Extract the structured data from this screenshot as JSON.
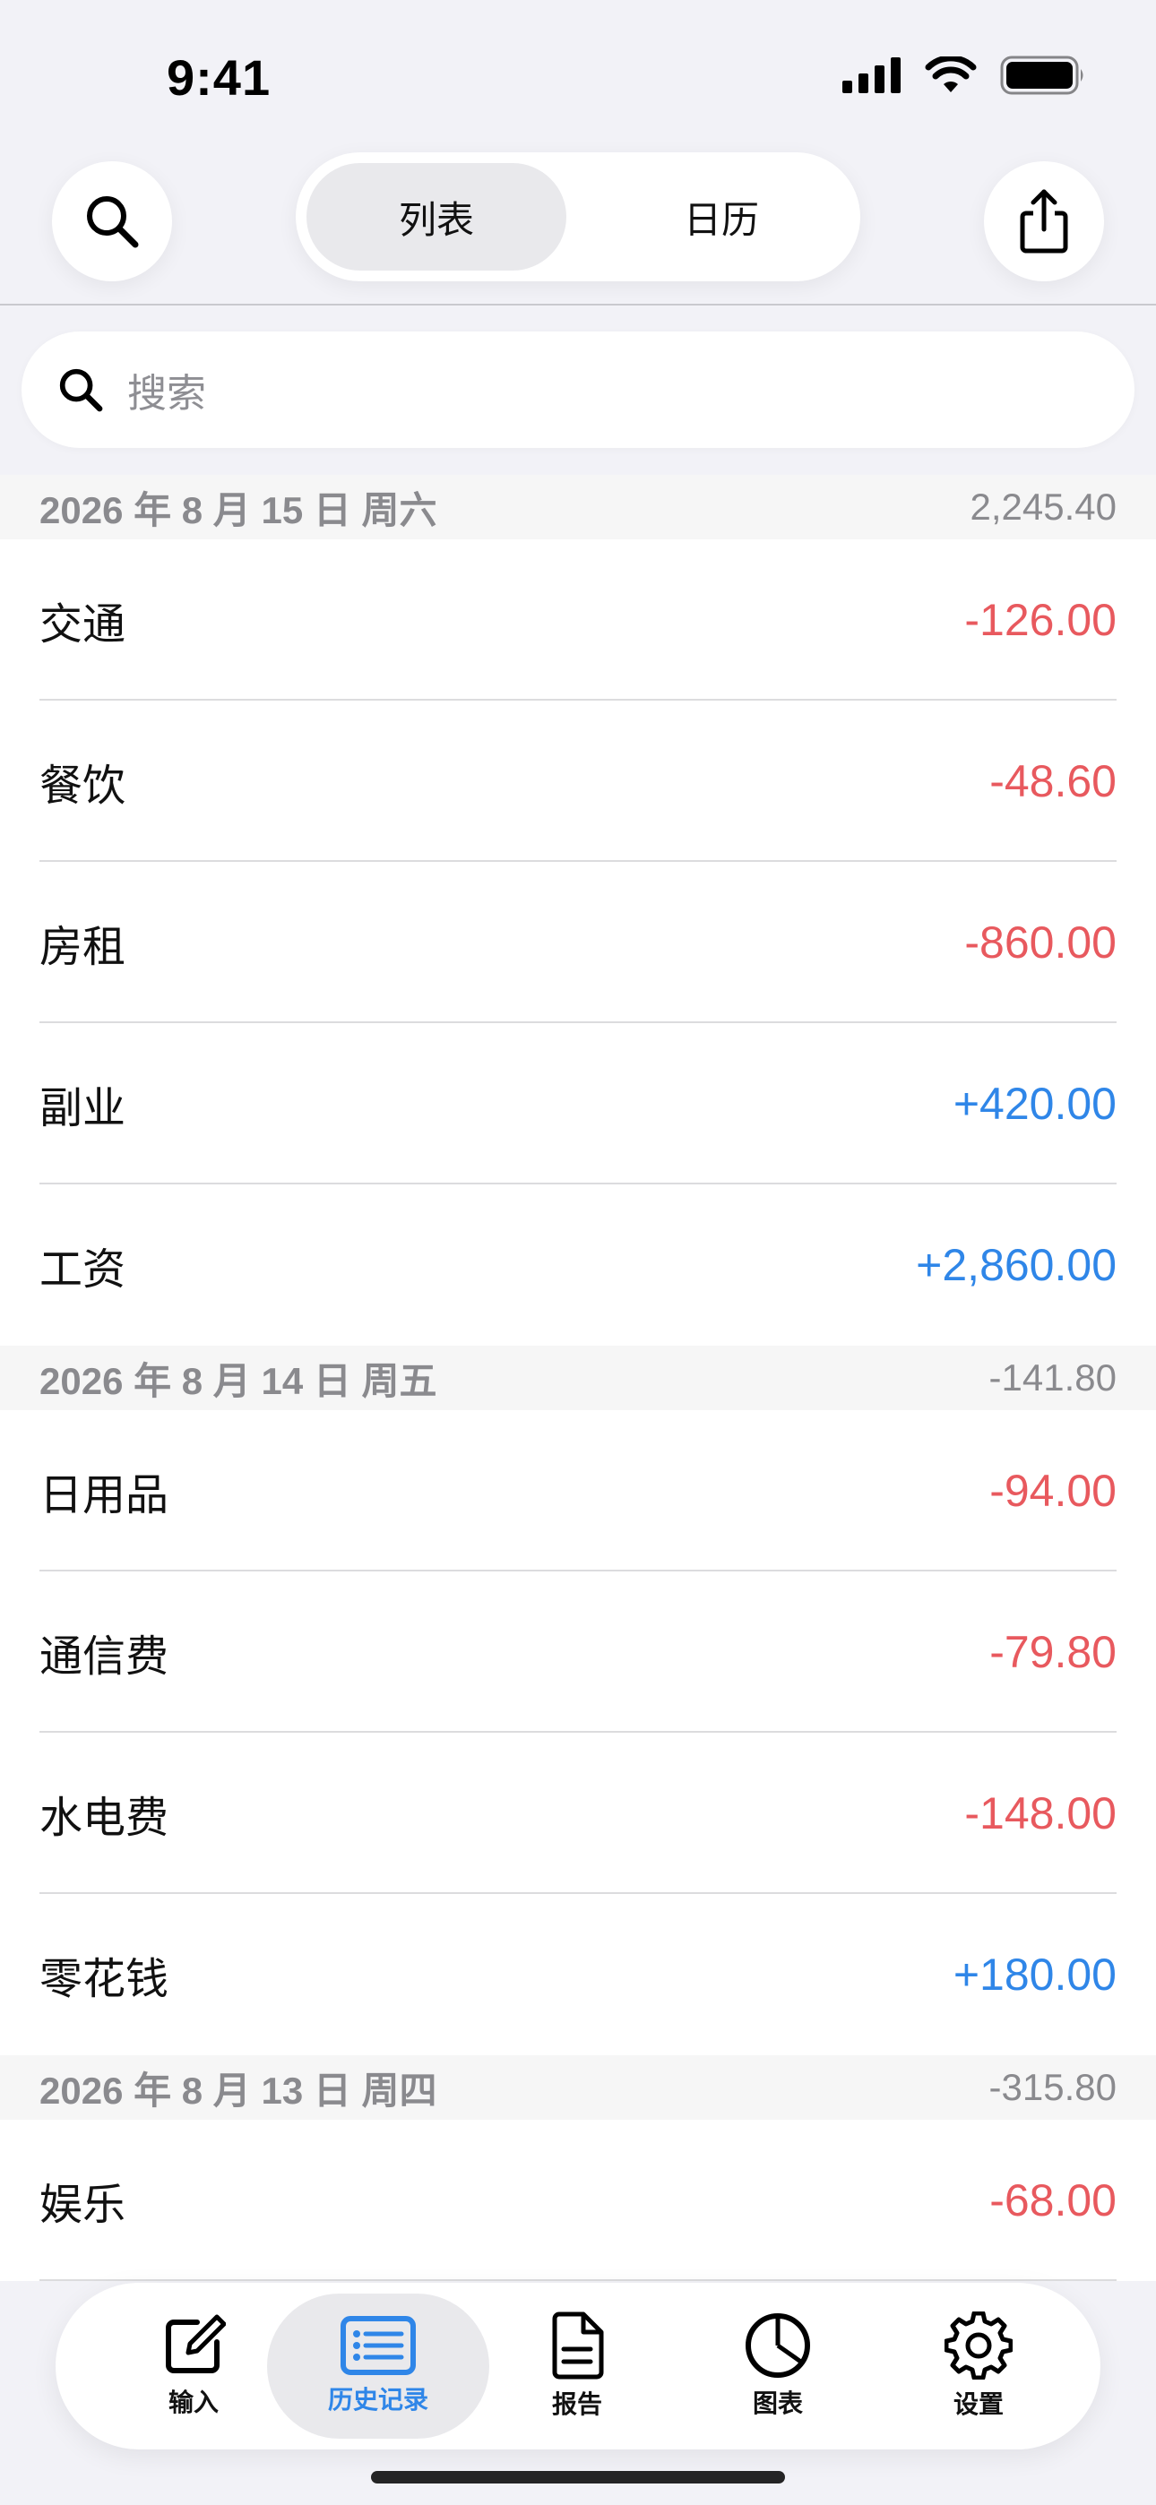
{
  "status_bar": {
    "time": "9:41"
  },
  "nav": {
    "segments": [
      {
        "label": "列表",
        "active": true
      },
      {
        "label": "日历",
        "active": false
      }
    ],
    "left_icon": "search-icon",
    "right_icon": "share-icon"
  },
  "search": {
    "placeholder": "搜索"
  },
  "sections": [
    {
      "date": "2026 年 8 月 15 日 周六",
      "total": "2,245.40",
      "rows": [
        {
          "label": "交通",
          "amount": "-126.00",
          "type": "neg"
        },
        {
          "label": "餐饮",
          "amount": "-48.60",
          "type": "neg"
        },
        {
          "label": "房租",
          "amount": "-860.00",
          "type": "neg"
        },
        {
          "label": "副业",
          "amount": "+420.00",
          "type": "pos"
        },
        {
          "label": "工资",
          "amount": "+2,860.00",
          "type": "pos"
        }
      ]
    },
    {
      "date": "2026 年 8 月 14 日 周五",
      "total": "-141.80",
      "rows": [
        {
          "label": "日用品",
          "amount": "-94.00",
          "type": "neg"
        },
        {
          "label": "通信费",
          "amount": "-79.80",
          "type": "neg"
        },
        {
          "label": "水电费",
          "amount": "-148.00",
          "type": "neg"
        },
        {
          "label": "零花钱",
          "amount": "+180.00",
          "type": "pos"
        }
      ]
    },
    {
      "date": "2026 年 8 月 13 日 周四",
      "total": "-315.80",
      "rows": [
        {
          "label": "娱乐",
          "amount": "-68.00",
          "type": "neg"
        }
      ]
    }
  ],
  "tabbar": {
    "tabs": [
      {
        "label": "输入",
        "icon": "compose-icon",
        "active": false
      },
      {
        "label": "历史记录",
        "icon": "list-icon",
        "active": true
      },
      {
        "label": "报告",
        "icon": "document-icon",
        "active": false
      },
      {
        "label": "图表",
        "icon": "pie-chart-icon",
        "active": false
      },
      {
        "label": "设置",
        "icon": "gear-icon",
        "active": false
      }
    ]
  },
  "colors": {
    "negative": "#e8595e",
    "positive": "#2f86e8",
    "accent": "#2f86e8"
  }
}
